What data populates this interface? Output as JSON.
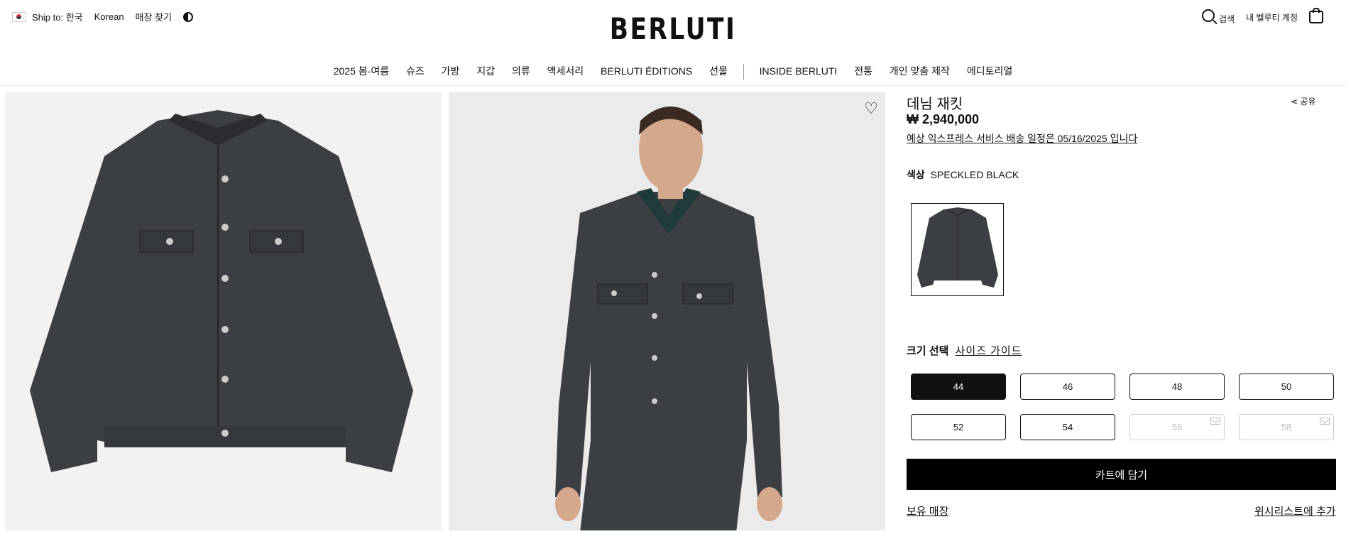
{
  "header": {
    "ship_to": "Ship to: 한국",
    "language": "Korean",
    "store_finder": "매장 찾기",
    "logo": "BERLUTI",
    "search": "검색",
    "account": "내 벨루티 계정"
  },
  "nav": {
    "items": [
      "2025 봄-여름",
      "슈즈",
      "가방",
      "지갑",
      "의류",
      "액세서리",
      "BERLUTI ÉDITIONS",
      "선물"
    ],
    "items2": [
      "INSIDE BERLUTI",
      "전통",
      "개인 맞춤 제작",
      "에디토리얼"
    ]
  },
  "product": {
    "title": "데님 재킷",
    "share": "공유",
    "price": "₩ 2,940,000",
    "delivery": "예상 익스프레스 서비스 배송 일정은 05/16/2025 입니다",
    "color_label": "색상",
    "color_value": "SPECKLED BLACK",
    "size_label": "크기 선택",
    "size_guide": "사이즈 가이드",
    "sizes": [
      "44",
      "46",
      "48",
      "50",
      "52",
      "54",
      "56",
      "58"
    ],
    "selected_size": "44",
    "unavailable_sizes": [
      "56",
      "58"
    ],
    "add_to_cart": "카트에 담기",
    "store_stock": "보유 매장",
    "wishlist": "위시리스트에 추가"
  },
  "colors": {
    "accent": "#000000",
    "denim": "#3b3e42"
  }
}
